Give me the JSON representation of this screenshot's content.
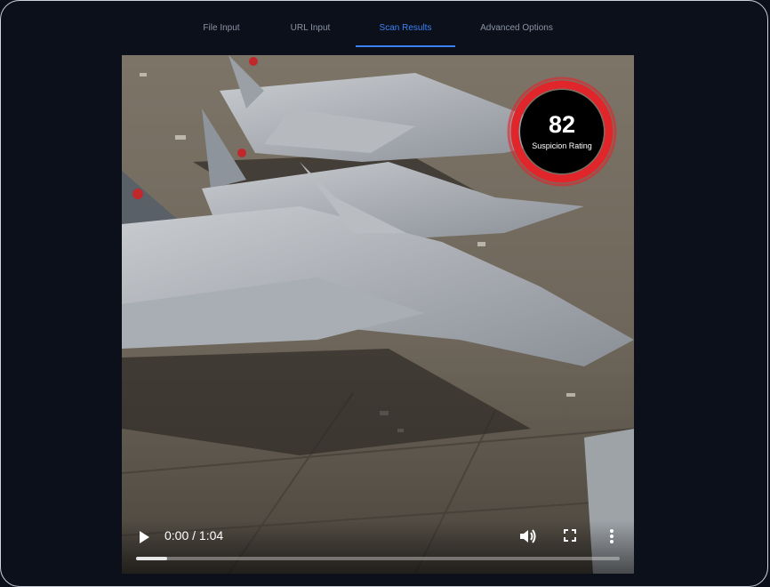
{
  "tabs": [
    {
      "label": "File Input",
      "active": false
    },
    {
      "label": "URL Input",
      "active": false
    },
    {
      "label": "Scan Results",
      "active": true
    },
    {
      "label": "Advanced Options",
      "active": false
    }
  ],
  "gauge": {
    "value": "82",
    "label": "Suspicion Rating",
    "ring_color": "#e0262b"
  },
  "video": {
    "time_display": "0:00 / 1:04",
    "progress_fraction": 0.065,
    "icons": [
      "play-icon",
      "volume-icon",
      "fullscreen-icon",
      "more-options-icon"
    ]
  },
  "colors": {
    "accent": "#3b82f6",
    "background": "#0b101b"
  }
}
